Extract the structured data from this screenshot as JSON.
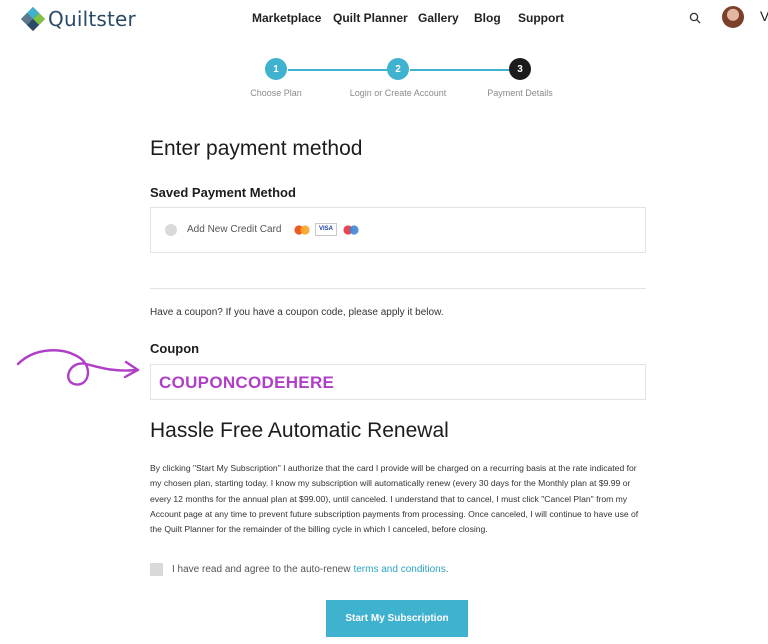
{
  "brand": {
    "name": "Quiltster"
  },
  "nav": {
    "items": [
      "Marketplace",
      "Quilt Planner",
      "Gallery",
      "Blog",
      "Support"
    ]
  },
  "header_icons": {
    "search": "search-icon",
    "avatar": "user-avatar",
    "overflow_glyph": "V"
  },
  "stepper": {
    "steps": [
      {
        "number": "1",
        "label": "Choose Plan",
        "state": "complete"
      },
      {
        "number": "2",
        "label": "Login or Create Account",
        "state": "complete"
      },
      {
        "number": "3",
        "label": "Payment Details",
        "state": "current"
      }
    ],
    "complete_color": "#3fb2cf",
    "current_color": "#1c1c1c"
  },
  "payment": {
    "title": "Enter payment method",
    "saved_heading": "Saved Payment Method",
    "add_card_label": "Add New Credit Card",
    "card_icons": [
      "mastercard-icon",
      "visa-icon",
      "maestro-icon"
    ],
    "visa_text": "VISA"
  },
  "coupon": {
    "help_text": "Have a coupon? If you have a coupon code, please apply it below.",
    "label": "Coupon",
    "value": "COUPONCODEHERE",
    "value_color": "#b03fc7"
  },
  "renewal": {
    "title": "Hassle Free Automatic Renewal",
    "body": "By clicking \"Start My Subscription\" I authorize that the card I provide will be charged on a recurring basis at the rate indicated for my chosen plan, starting today. I know my subscription will automatically renew (every 30 days for the Monthly plan at $9.99 or every 12 months for the annual plan at $99.00), until canceled. I understand that to cancel, I must click \"Cancel Plan\" from my Account page at any time to prevent future subscription payments from processing. Once canceled, I will continue to have use of the Quilt Planner for the remainder of the billing cycle in which I canceled, before closing.",
    "agree_text": "I have read and agree to the auto-renew",
    "agree_link": "terms and conditions",
    "agree_suffix": ".",
    "submit_label": "Start My Subscription"
  },
  "colors": {
    "accent": "#3fb2cf",
    "link": "#2aa3c4",
    "annotation": "#b03fc7"
  }
}
